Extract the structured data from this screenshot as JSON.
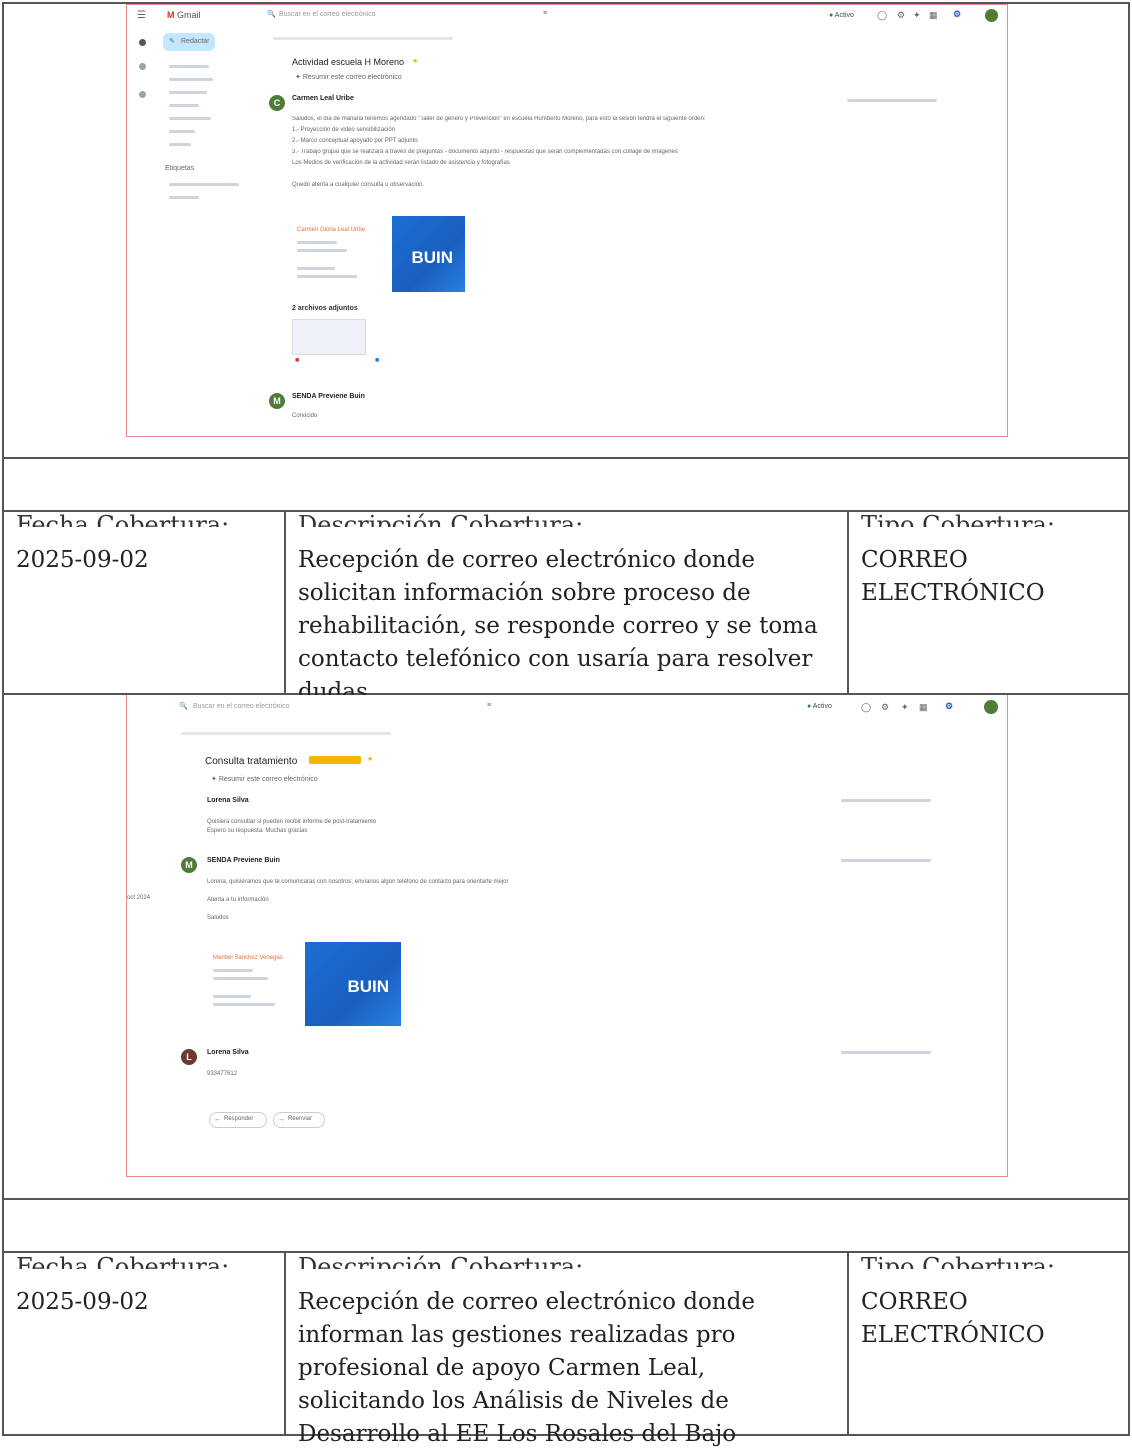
{
  "screenshot1": {
    "app_name": "Gmail",
    "search_placeholder": "Buscar en el correo electrónico",
    "status": "Activo",
    "compose_label": "Redactar",
    "subject": "Actividad escuela H Moreno",
    "summary_chip": "Resumir este correo electrónico",
    "sender": "Carmen Leal Uribe",
    "body_lines": [
      "Saludos, el día de mañana tenemos agendado \"Taller de género y Prevención\" en escuela Humberto Moreno, para esto la sesión tendrá el siguiente orden:",
      "1.- Proyección de video sensibilización",
      "2.- Marco conceptual apoyado por PPT adjunto",
      "3.- Trabajo grupal que se realizará a través de preguntas - documento adjunto - respuestas que serán complementadas con collage de imágenes",
      "Los Medios de verificación de la actividad serán listado de asistencia y fotografías",
      "Quedo atenta a cualquier consulta u observación."
    ],
    "signature_name": "Carmen Gloria Leal Uribe",
    "logo_text": "BUIN",
    "attachments_label": "2 archivos adjuntos",
    "reply_sender": "SENDA Previene Buin",
    "reply_body": "Conocido",
    "avatar_initial_1": "C",
    "avatar_initial_2": "M",
    "labels_heading": "Etiquetas"
  },
  "row1": {
    "fecha_label": "Fecha Cobertura:",
    "fecha_value": "2025-09-02",
    "descripcion_label": "Descripción Cobertura:",
    "descripcion_value": "Recepción de correo electrónico donde solicitan información sobre proceso de rehabilitación, se responde correo y se toma contacto telefónico con usaría para resolver dudas",
    "tipo_label": "Tipo Cobertura:",
    "tipo_value": "CORREO ELECTRÓNICO"
  },
  "screenshot2": {
    "search_placeholder": "Buscar en el correo electrónico",
    "status": "Activo",
    "subject": "Consulta tratamiento",
    "summary_chip": "Resumir este correo electrónico",
    "sender_1": "Lorena Silva",
    "body_1a": "Quisiera consultar si pueden recibir informe de post-tratamiento",
    "body_1b": "Espero su respuesta. Muchas gracias",
    "sender_2": "SENDA Previene Buin",
    "body_2a": "Lorena, quisiéramos que te comunicaras con nosotros, envíanos algún teléfono de contacto para orientarte mejor",
    "body_2b": "Atenta a tu información",
    "body_2c": "Saludos",
    "signature_name": "Maribel Sanchez Venegas",
    "logo_text": "BUIN",
    "sender_3": "Lorena Silva",
    "body_3": "933477612",
    "reply_btn": "Responder",
    "forward_btn": "Reenviar",
    "avatar_initial_2": "M",
    "avatar_initial_3": "L",
    "side_date": "oct 2024"
  },
  "row2": {
    "fecha_label": "Fecha Cobertura:",
    "fecha_value": "2025-09-02",
    "descripcion_label": "Descripción Cobertura:",
    "descripcion_value": "Recepción de correo electrónico donde informan las gestiones realizadas pro profesional de apoyo Carmen Leal, solicitando los Análisis de Niveles de Desarrollo al EE Los Rosales del Bajo",
    "tipo_label": "Tipo Cobertura:",
    "tipo_value": "CORREO ELECTRÓNICO"
  }
}
